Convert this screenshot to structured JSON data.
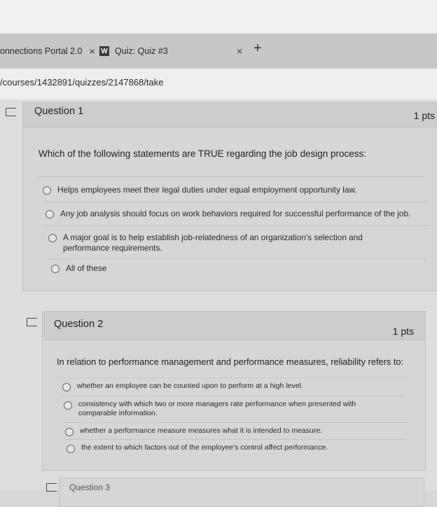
{
  "browser": {
    "tabs": [
      {
        "label": "onnections Portal 2.0",
        "close": "×"
      },
      {
        "label": "Quiz: Quiz #3",
        "logo": "W",
        "close": "×"
      }
    ],
    "new_tab": "+",
    "url": "/courses/1432891/quizzes/2147868/take"
  },
  "questions": [
    {
      "title": "Question 1",
      "points": "1 pts",
      "text": "Which of the following statements are TRUE regarding the job design process:",
      "answers": [
        "Helps employees meet their legal duties under equal employment opportunity law.",
        "Any job analysis should focus on work behaviors required for successful performance of the job.",
        "A major goal is to help establish job-relatedness of an organization's selection and performance requirements.",
        "All of these"
      ]
    },
    {
      "title": "Question 2",
      "points": "1 pts",
      "text": "In relation to performance management and performance measures, reliability refers to:",
      "answers": [
        "whether an employee can be counted upon to perform at a high level.",
        "consistency with which two or more managers rate performance when presented with comparable information.",
        "whether a performance measure measures what it is intended to measure.",
        "the extent to which factors out of the employee's control affect performance."
      ]
    },
    {
      "title": "Question 3"
    }
  ],
  "colors": {
    "radio": "#5b6a7a",
    "card": "#d8d6d4",
    "page": "#dfdddb"
  }
}
